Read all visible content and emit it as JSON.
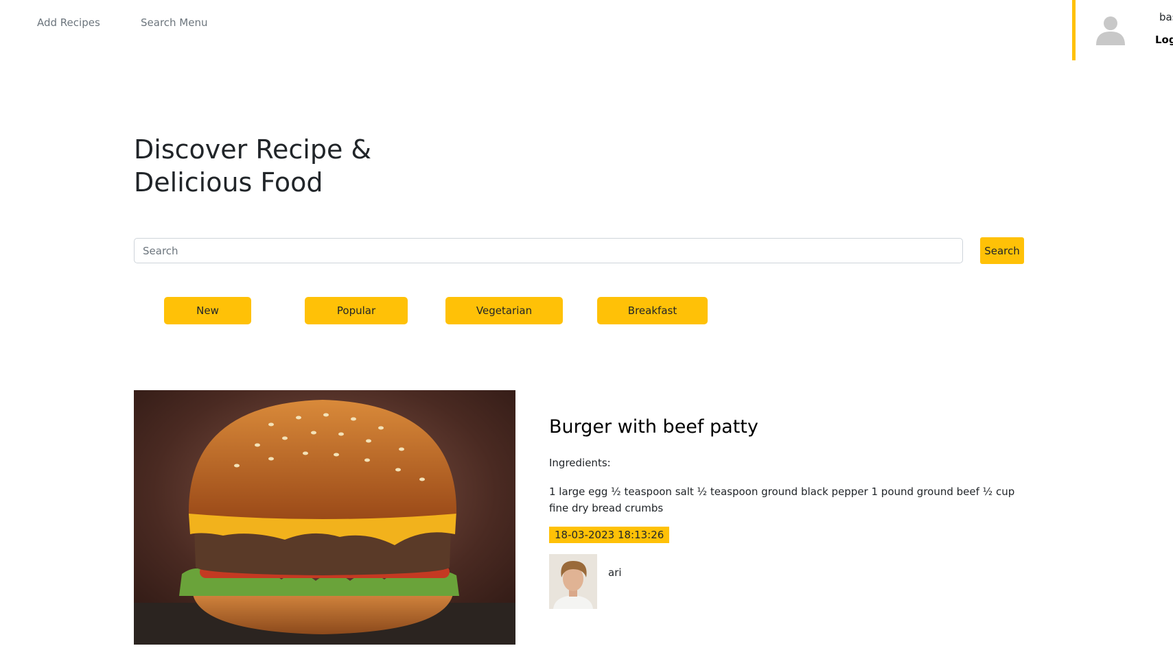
{
  "nav": {
    "add_recipes": "Add Recipes",
    "search_menu": "Search Menu"
  },
  "user": {
    "name": "bas",
    "logout": "Logo"
  },
  "hero": {
    "line1": "Discover Recipe &",
    "line2": "Delicious Food"
  },
  "search": {
    "placeholder": "Search",
    "button_label": "Search"
  },
  "categories": {
    "new": "New",
    "popular": "Popular",
    "vegetarian": "Vegetarian",
    "breakfast": "Breakfast"
  },
  "recipe": {
    "title": "Burger with beef patty",
    "ingredients_label": "Ingredients:",
    "ingredients": "1 large egg ½ teaspoon salt ½ teaspoon ground black pepper 1 pound ground beef ½ cup fine dry bread crumbs",
    "date": "18-03-2023 18:13:26",
    "author": "ari"
  },
  "colors": {
    "accent": "#ffc107",
    "text": "#212529",
    "nav_text": "#6c757d"
  },
  "icons": {
    "user_avatar": "user-silhouette-icon"
  }
}
